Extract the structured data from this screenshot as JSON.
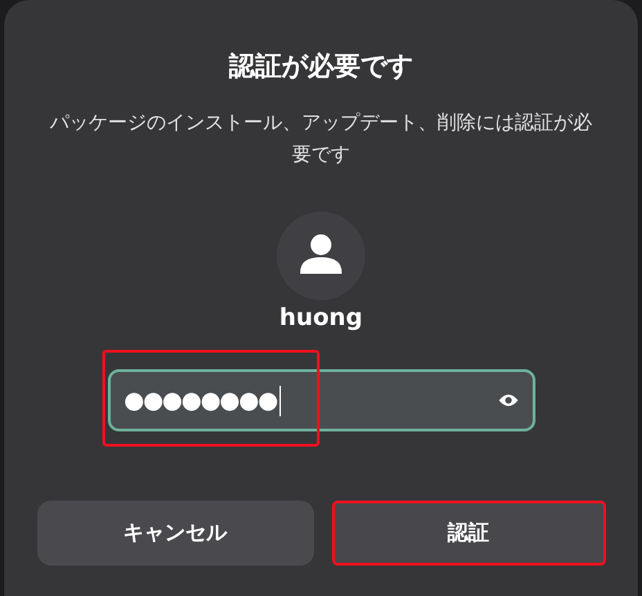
{
  "dialog": {
    "title": "認証が必要です",
    "message": "パッケージのインストール、アップデート、削除には認証が必要です"
  },
  "user": {
    "name": "huong"
  },
  "password": {
    "value": "●●●●●●●●",
    "focused": true,
    "highlighted": true
  },
  "buttons": [
    {
      "label": "キャンセル",
      "highlighted": false
    },
    {
      "label": "認証",
      "highlighted": true
    }
  ]
}
